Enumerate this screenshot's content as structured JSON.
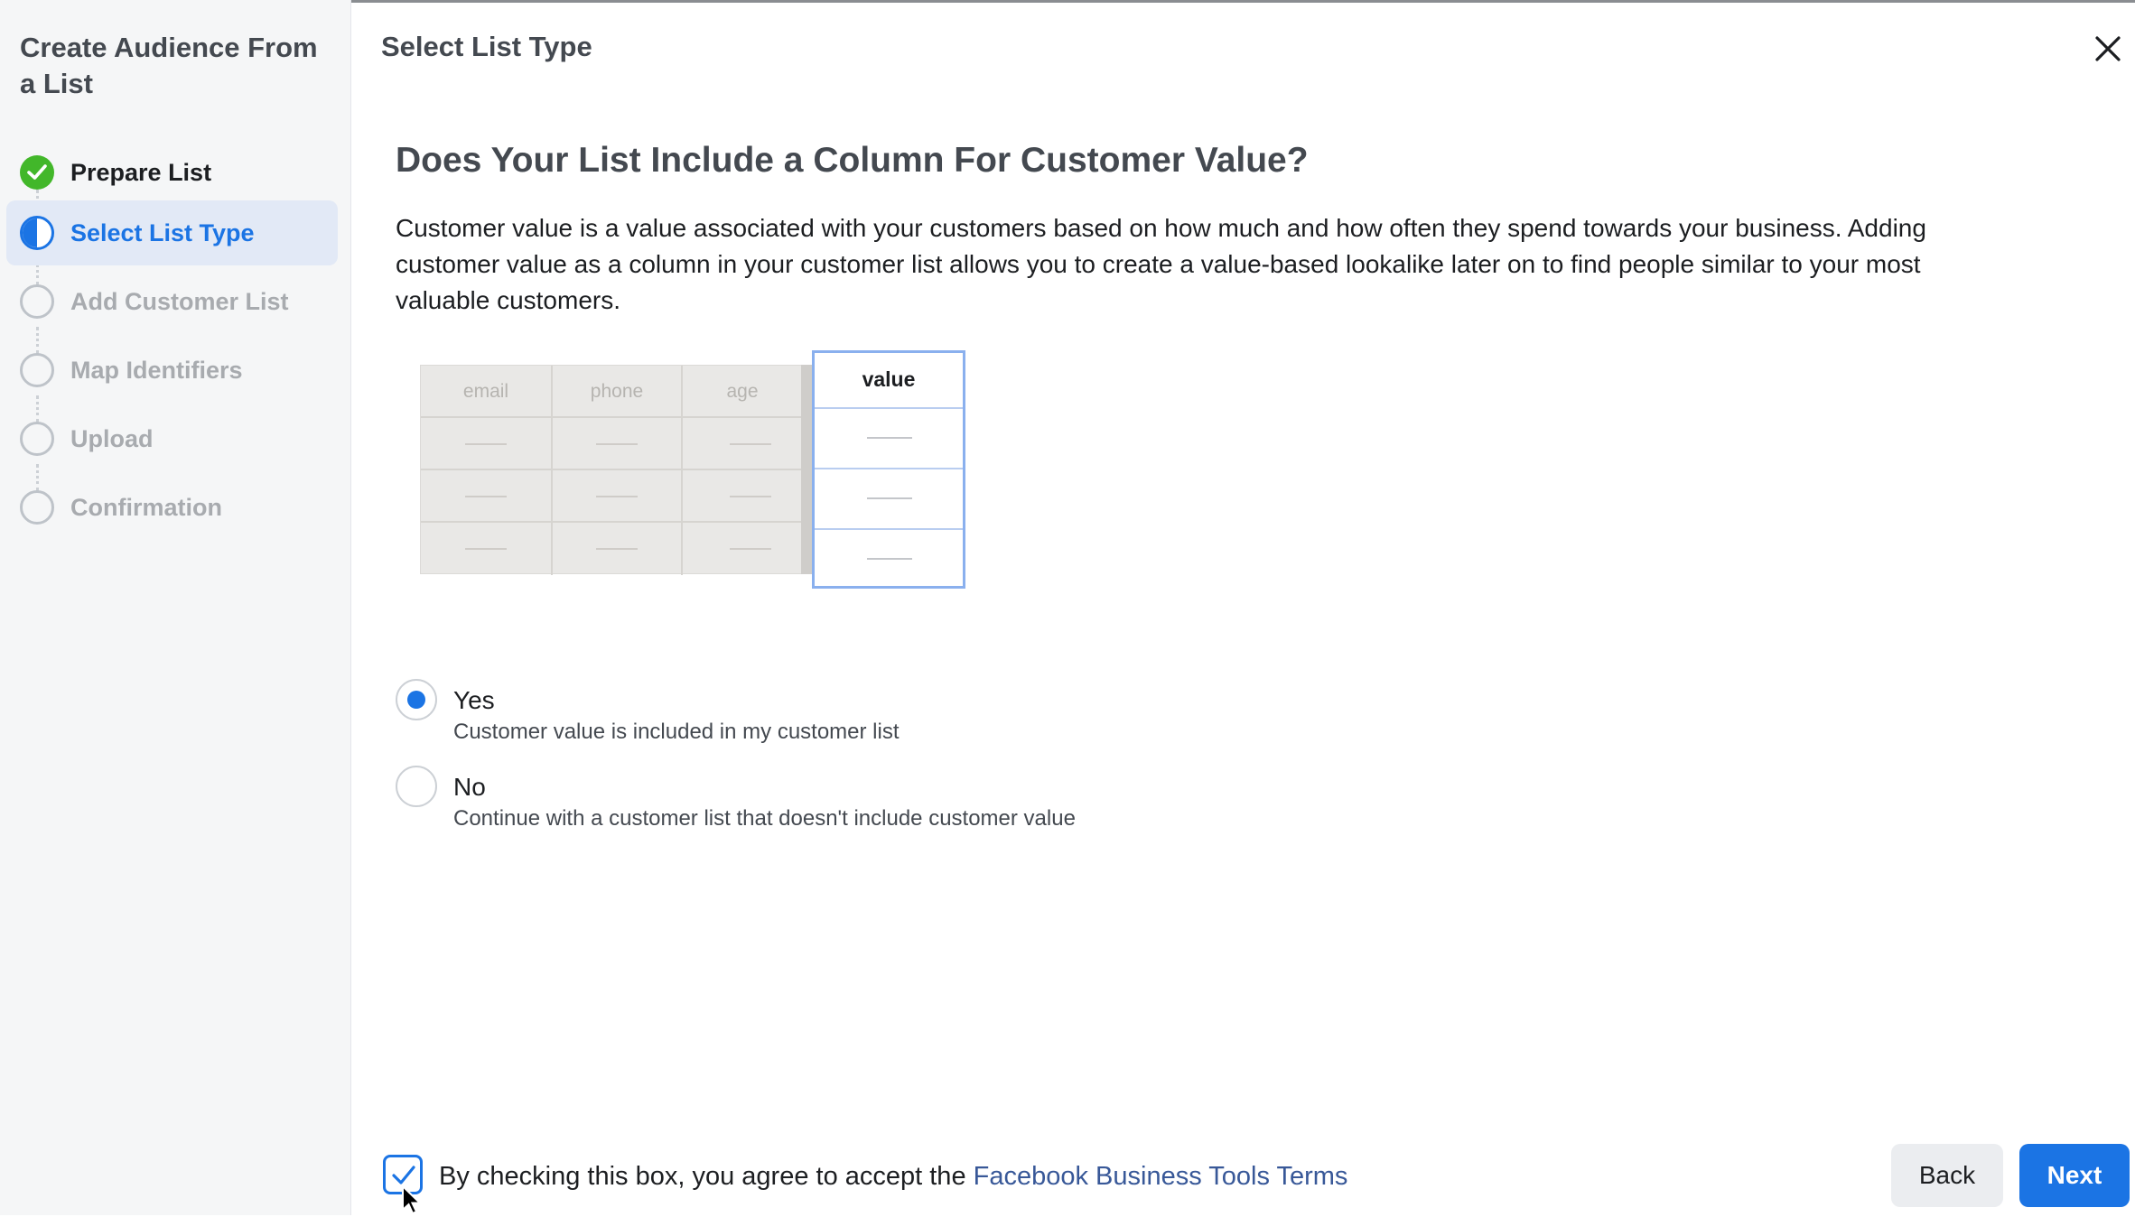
{
  "sidebar": {
    "title": "Create Audience From a List",
    "steps": [
      {
        "label": "Prepare List",
        "status": "completed"
      },
      {
        "label": "Select List Type",
        "status": "current"
      },
      {
        "label": "Add Customer List",
        "status": "pending"
      },
      {
        "label": "Map Identifiers",
        "status": "pending"
      },
      {
        "label": "Upload",
        "status": "pending"
      },
      {
        "label": "Confirmation",
        "status": "pending"
      }
    ]
  },
  "header": {
    "title": "Select List Type",
    "close_icon": "close-icon"
  },
  "main": {
    "question": "Does Your List Include a Column For Customer Value?",
    "description": "Customer value is a value associated with your customers based on how much and how often they spend towards your business. Adding customer value as a column in your customer list allows you to create a value-based lookalike later on to find people similar to your most valuable customers.",
    "illustration": {
      "columns": [
        "email",
        "phone",
        "age"
      ],
      "highlight_column": "value"
    },
    "options": [
      {
        "title": "Yes",
        "subtitle": "Customer value is included in my customer list",
        "selected": true
      },
      {
        "title": "No",
        "subtitle": "Continue with a customer list that doesn't include customer value",
        "selected": false
      }
    ]
  },
  "footer": {
    "terms_checked": true,
    "terms_text": "By checking this box, you agree to accept the",
    "terms_link": "Facebook Business Tools Terms",
    "back_label": "Back",
    "next_label": "Next"
  },
  "colors": {
    "accent": "#1b74e4",
    "success": "#42b72a",
    "link": "#385898"
  }
}
